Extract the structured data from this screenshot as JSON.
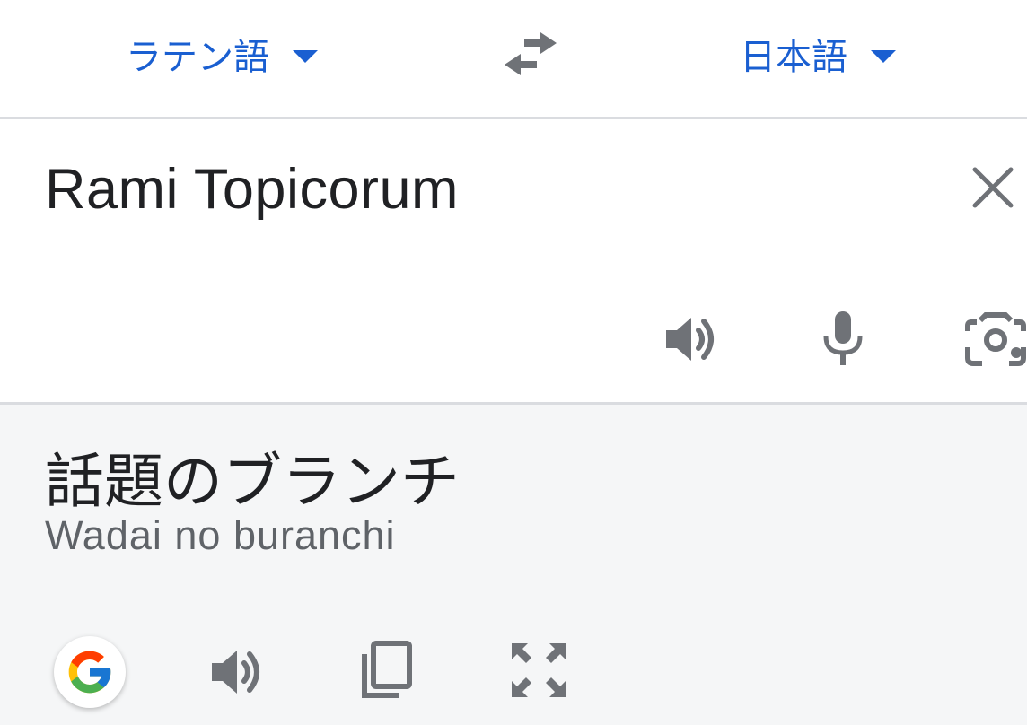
{
  "header": {
    "source_language": "ラテン語",
    "target_language": "日本語"
  },
  "input": {
    "text": "Rami Topicorum"
  },
  "output": {
    "translation": "話題のブランチ",
    "romanization": "Wadai no buranchi"
  },
  "colors": {
    "accent": "#1a5fd1",
    "icon": "#6f7277",
    "output_bg": "#f5f6f7"
  },
  "icons": [
    "swap-languages-icon",
    "clear-icon",
    "speaker-icon",
    "microphone-icon",
    "camera-lens-icon",
    "google-logo-icon",
    "copy-icon",
    "fullscreen-icon"
  ]
}
